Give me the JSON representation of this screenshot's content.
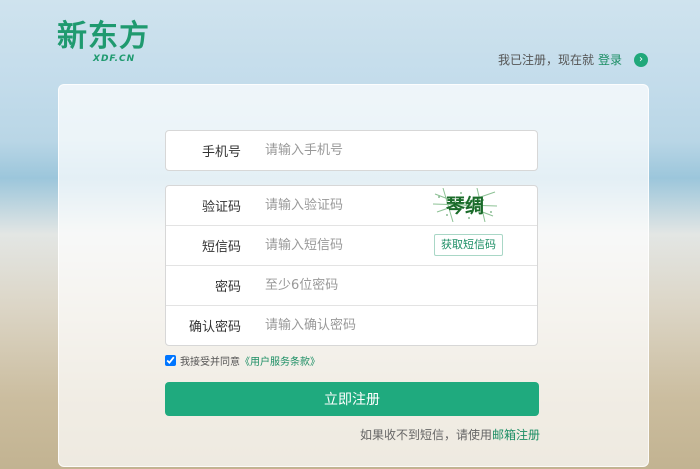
{
  "brand": {
    "name": "新东方",
    "sub": "XDF.CN",
    "color": "#1f9a6f"
  },
  "header": {
    "already_text": "我已注册，现在就",
    "login_link": "登录",
    "go_icon": "arrow-right-circle-icon"
  },
  "form": {
    "phone": {
      "label": "手机号",
      "placeholder": "请输入手机号"
    },
    "captcha": {
      "label": "验证码",
      "placeholder": "请输入验证码",
      "image_text": "琴绸"
    },
    "sms": {
      "label": "短信码",
      "placeholder": "请输入短信码",
      "button": "获取短信码"
    },
    "password": {
      "label": "密码",
      "placeholder": "至少6位密码"
    },
    "confirm": {
      "label": "确认密码",
      "placeholder": "请输入确认密码"
    },
    "agree": {
      "text": "我接受并同意",
      "link": "《用户服务条款》",
      "checked": true
    },
    "submit": "立即注册",
    "tip_text": "如果收不到短信，请使用",
    "tip_link": "邮箱注册"
  },
  "colors": {
    "accent": "#1faa7e",
    "link": "#1b8e64"
  }
}
